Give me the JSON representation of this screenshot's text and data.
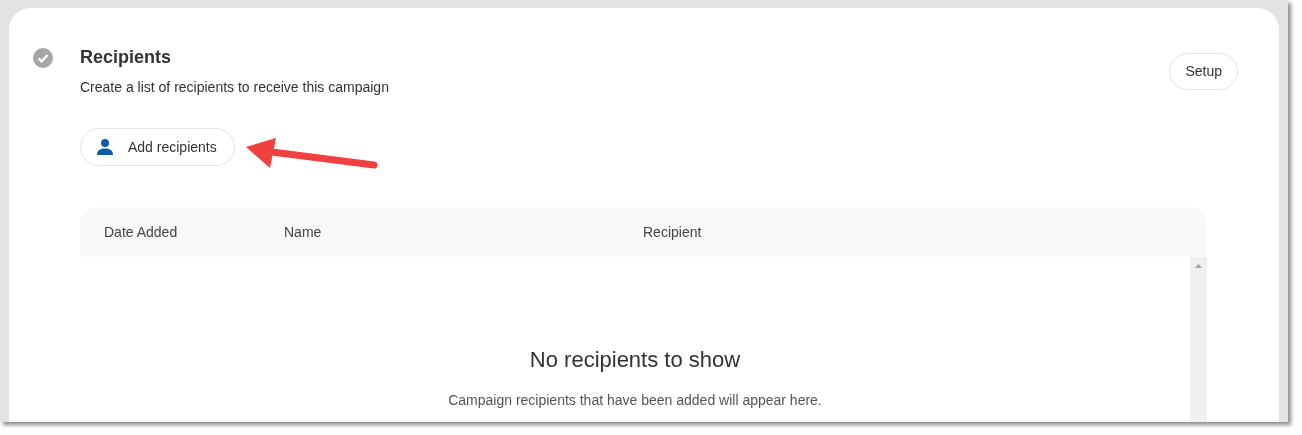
{
  "section": {
    "title": "Recipients",
    "description": "Create a list of recipients to receive this campaign",
    "completed": true
  },
  "setup_button": "Setup",
  "add_button": "Add recipients",
  "table": {
    "columns": [
      "Date Added",
      "Name",
      "Recipient"
    ],
    "empty_state": {
      "title": "No recipients to show",
      "message": "Campaign recipients that have been added will appear here."
    }
  }
}
